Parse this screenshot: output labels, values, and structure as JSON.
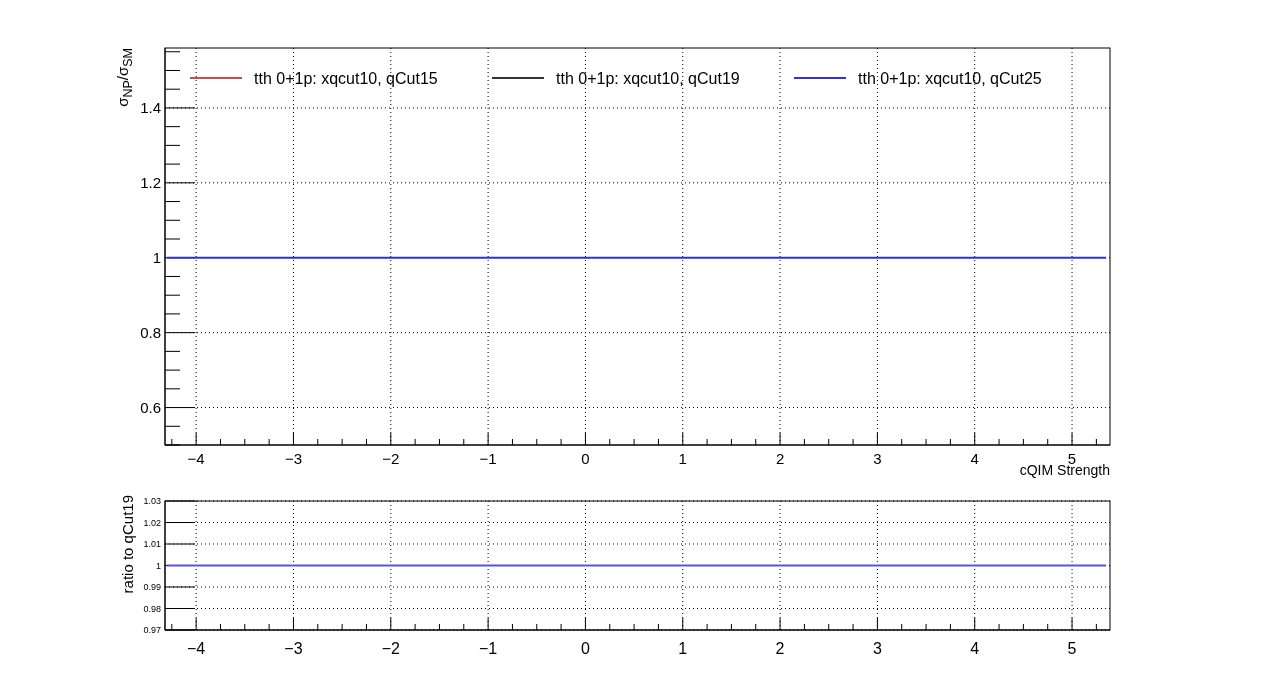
{
  "plot": {
    "chart_data": {
      "type": "line",
      "xlabel": "cQIM Strength",
      "ylabel": "σ$_{NP}$/σ$_{SM}$",
      "x": [
        -4.3,
        5.35
      ],
      "series": [
        {
          "name": "tth 0+1p: xqcut10, qCut15",
          "color": "#cc4c4c",
          "values": [
            null,
            null
          ]
        },
        {
          "name": "tth 0+1p: xqcut10, qCut19",
          "color": "#333333",
          "values": [
            null,
            null
          ]
        },
        {
          "name": "tth 0+1p: xqcut10, qCut25",
          "color": "#3333dd",
          "values": [
            1,
            1
          ]
        }
      ],
      "grid": true,
      "legend": true,
      "xlim": [
        -4.32,
        5.39
      ],
      "ylim": [
        0.5,
        1.56
      ],
      "xticks": [
        {
          "value": -4,
          "label": "−4"
        },
        {
          "value": -3,
          "label": "−3"
        },
        {
          "value": -2,
          "label": "−2"
        },
        {
          "value": -1,
          "label": "−1"
        },
        0,
        1,
        2,
        3,
        4,
        5
      ],
      "yticks": [
        0.6,
        0.8,
        1,
        1.2,
        1.4
      ]
    }
  },
  "ratio_plot": {
    "chart_data": {
      "type": "line",
      "ylabel": "ratio to qCut19",
      "x": [
        -4.3,
        5.35
      ],
      "series": [
        {
          "color": "#5555dd",
          "values": [
            1,
            1
          ]
        }
      ],
      "grid": true,
      "xlim": [
        -4.32,
        5.39
      ],
      "ylim": [
        0.97,
        1.03
      ],
      "xticks": [
        {
          "value": -4,
          "label": "−4"
        },
        {
          "value": -3,
          "label": "−3"
        },
        {
          "value": -2,
          "label": "−2"
        },
        {
          "value": -1,
          "label": "−1"
        },
        0,
        1,
        2,
        3,
        4,
        5
      ],
      "yticks": [
        0.97,
        0.98,
        0.99,
        1,
        1.01,
        1.02,
        1.03
      ]
    }
  }
}
